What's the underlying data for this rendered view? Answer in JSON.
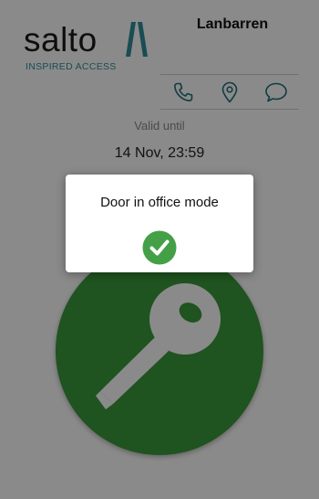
{
  "brand": {
    "wordmark": "salto",
    "tagline": "INSPIRED ACCESS"
  },
  "header": {
    "site_name": "Lanbarren"
  },
  "contact_actions": [
    {
      "icon": "phone-icon"
    },
    {
      "icon": "location-pin-icon"
    },
    {
      "icon": "chat-bubble-icon"
    }
  ],
  "key": {
    "valid_label": "Valid until",
    "valid_date": "14 Nov, 23:59",
    "icon": "key-icon"
  },
  "alert": {
    "message": "Door in office mode",
    "icon": "check-circle-icon"
  },
  "colors": {
    "brand_teal": "#2f8e99",
    "key_button_green": "#3a9a3a",
    "check_green": "#43a047",
    "contact_icon_teal": "#1e6f7a"
  }
}
